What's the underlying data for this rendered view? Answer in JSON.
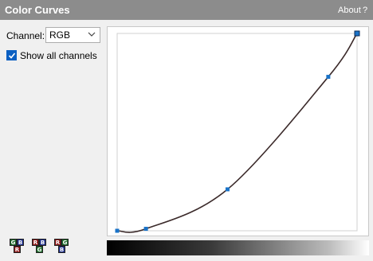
{
  "window": {
    "title": "Color Curves",
    "about_label": "About",
    "help_label": "?"
  },
  "controls": {
    "channel_label": "Channel:",
    "channel_value": "RGB",
    "show_all_label": "Show all channels",
    "show_all_checked": true
  },
  "swap_buttons": [
    {
      "icon": "swap-green-blue-red-icon",
      "letters": [
        "G",
        "B",
        "R"
      ]
    },
    {
      "icon": "swap-red-blue-green-icon",
      "letters": [
        "R",
        "B",
        "G"
      ]
    },
    {
      "icon": "swap-red-green-blue-icon",
      "letters": [
        "R",
        "G",
        "B"
      ]
    }
  ],
  "curve": {
    "points": [
      [
        0,
        0
      ],
      [
        0.12,
        0.01
      ],
      [
        0.46,
        0.21
      ],
      [
        0.88,
        0.78
      ],
      [
        1,
        1
      ]
    ],
    "line_color": "#3b2a2a",
    "point_color": "#1a73c8"
  },
  "colors": {
    "titlebar": "#8c8c8c",
    "accent": "#0a5fc2"
  }
}
